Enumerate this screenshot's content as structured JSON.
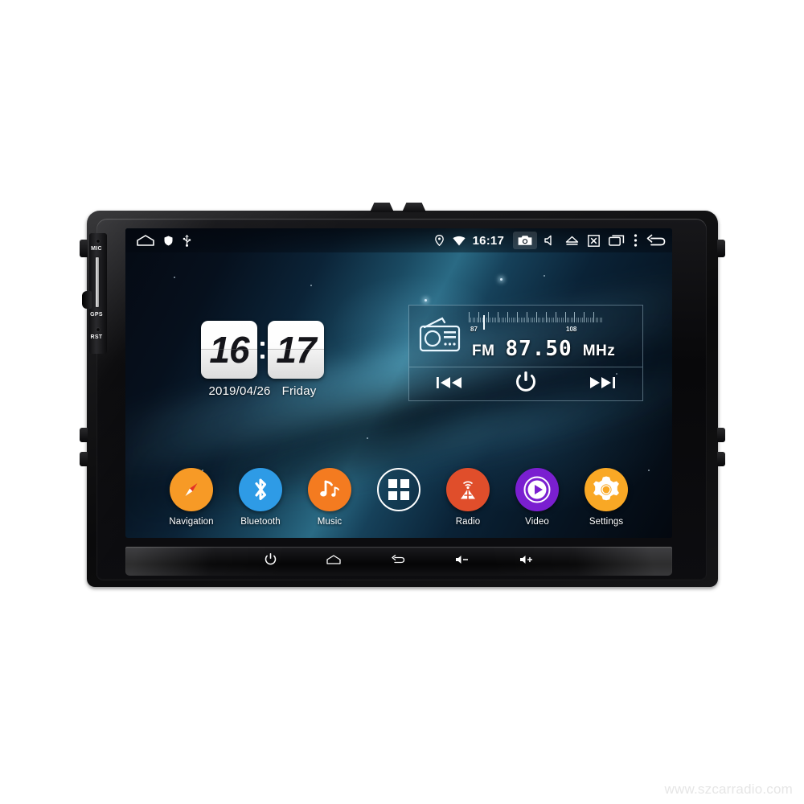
{
  "device": {
    "type": "android-car-head-unit",
    "side_labels": [
      "MIC",
      "GPS",
      "RST"
    ]
  },
  "statusbar": {
    "left_icons": [
      "home-icon",
      "shield-icon",
      "usb-icon"
    ],
    "right_icons": [
      "location-icon",
      "wifi-icon",
      "camera-icon",
      "mute-icon",
      "eject-icon",
      "screen-off-icon",
      "recents-icon",
      "overflow-menu-icon",
      "back-icon"
    ],
    "time": "16:17"
  },
  "clock": {
    "hours": "16",
    "minutes": "17",
    "date": "2019/04/26",
    "weekday": "Friday"
  },
  "radio": {
    "band": "FM",
    "frequency": "87.50",
    "unit": "MHz",
    "scale_min": "87",
    "scale_max": "108",
    "controls": [
      "previous-icon",
      "power-icon",
      "next-icon"
    ]
  },
  "dock": {
    "apps": [
      {
        "label": "Navigation",
        "icon": "compass-icon",
        "color": "#F79A26"
      },
      {
        "label": "Bluetooth",
        "icon": "bluetooth-icon",
        "color": "#2E9BE6"
      },
      {
        "label": "Music",
        "icon": "music-note-icon",
        "color": "#F47B20"
      },
      {
        "label": "",
        "icon": "apps-grid-icon",
        "color": "transparent"
      },
      {
        "label": "Radio",
        "icon": "radio-tower-icon",
        "color": "#E04E2B"
      },
      {
        "label": "Video",
        "icon": "play-icon",
        "color": "#7A1FD0"
      },
      {
        "label": "Settings",
        "icon": "gear-icon",
        "color": "#F9A825"
      }
    ]
  },
  "touchbar": {
    "buttons": [
      "power-icon",
      "home-icon",
      "back-icon",
      "volume-down-icon",
      "volume-up-icon"
    ]
  },
  "watermark": "www.szcarradio.com",
  "colors": {
    "accent_orange": "#F79A26",
    "accent_blue": "#2E9BE6",
    "accent_purple": "#7A1FD0",
    "accent_red": "#E04E2B",
    "screen_bg": "#05080f"
  }
}
